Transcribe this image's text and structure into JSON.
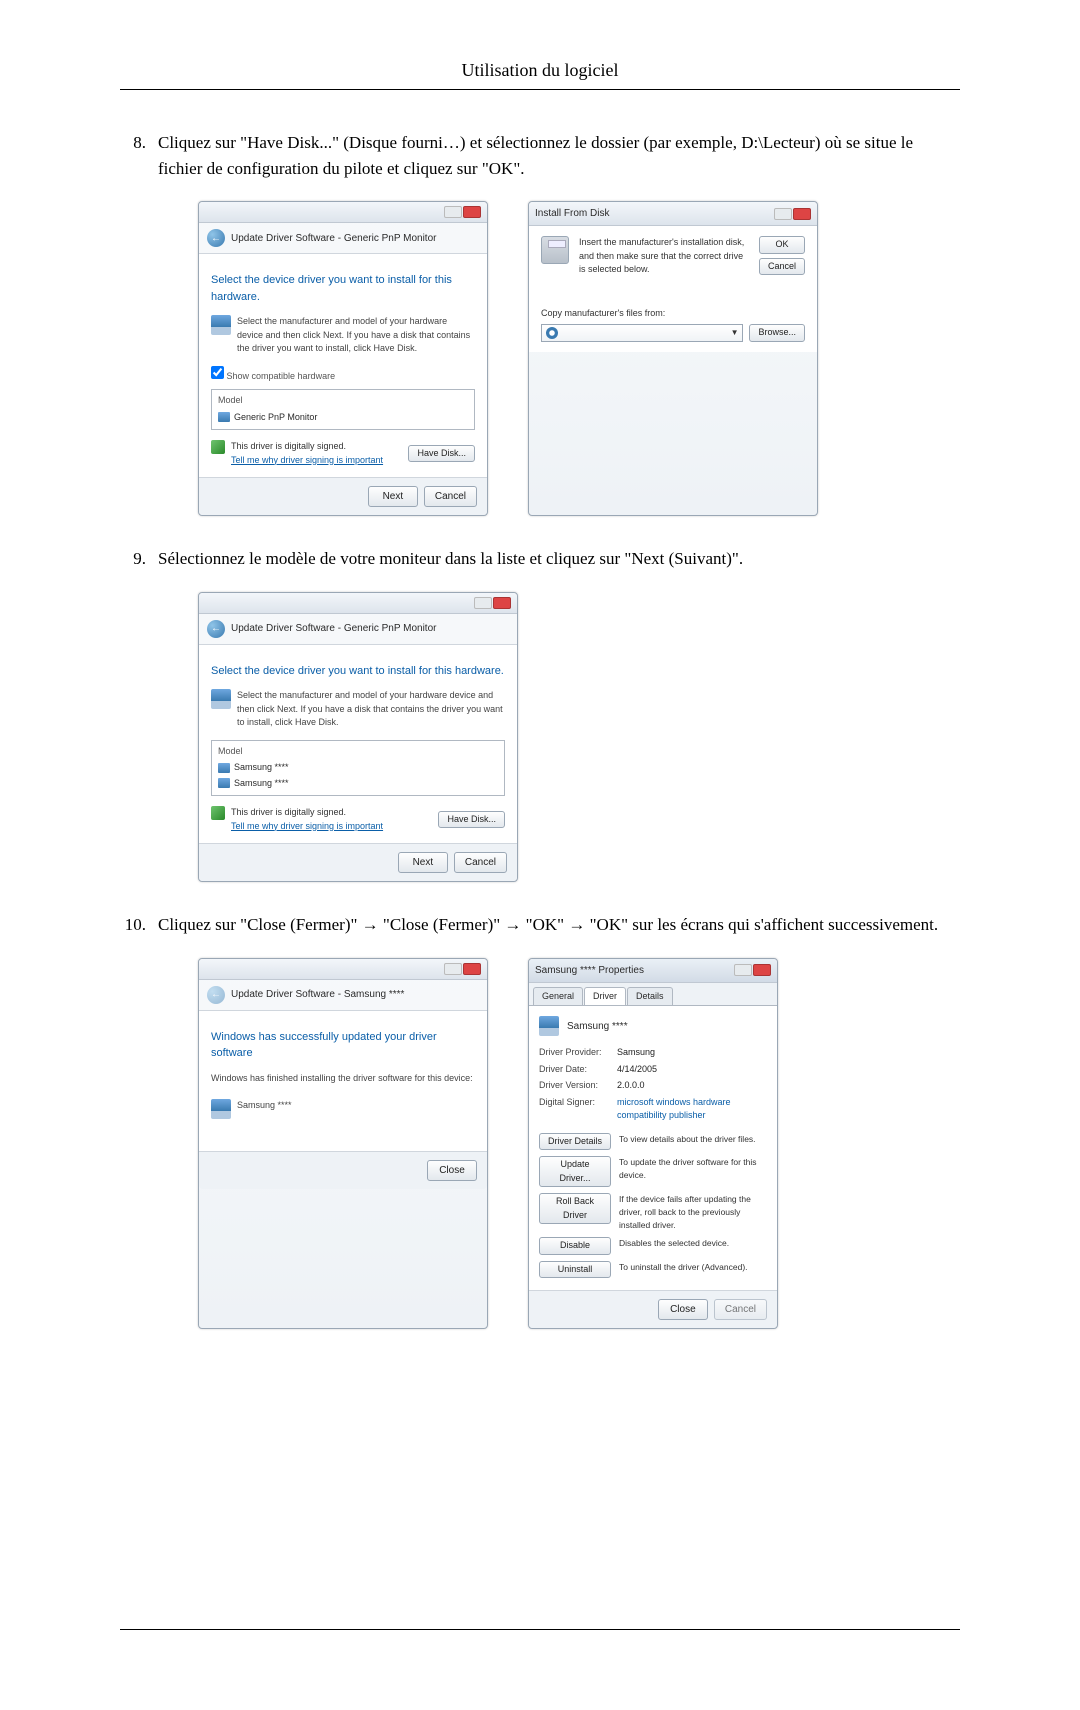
{
  "page": {
    "header": "Utilisation du logiciel"
  },
  "steps": {
    "s8": {
      "num": "8.",
      "text": "Cliquez sur \"Have Disk...\" (Disque fourni…) et sélectionnez le dossier (par exemple, D:\\Lecteur) où se situe le fichier de configuration du pilote et cliquez sur \"OK\"."
    },
    "s9": {
      "num": "9.",
      "text": "Sélectionnez le modèle de votre moniteur dans la liste et cliquez sur \"Next (Suivant)\"."
    },
    "s10": {
      "num": "10.",
      "text": "Cliquez sur \"Close (Fermer)\" → \"Close (Fermer)\" → \"OK\" → \"OK\" sur les écrans qui s'affichent successivement."
    }
  },
  "dlg1": {
    "breadcrumb": "Update Driver Software - Generic PnP Monitor",
    "heading": "Select the device driver you want to install for this hardware.",
    "sub": "Select the manufacturer and model of your hardware device and then click Next. If you have a disk that contains the driver you want to install, click Have Disk.",
    "chk": "Show compatible hardware",
    "list_label": "Model",
    "list_item": "Generic PnP Monitor",
    "sig1": "This driver is digitally signed.",
    "sig2": "Tell me why driver signing is important",
    "have_disk": "Have Disk...",
    "next": "Next",
    "cancel": "Cancel"
  },
  "dlg_ifd": {
    "title": "Install From Disk",
    "instr": "Insert the manufacturer's installation disk, and then make sure that the correct drive is selected below.",
    "ok": "OK",
    "cancel": "Cancel",
    "copy_label": "Copy manufacturer's files from:",
    "browse": "Browse..."
  },
  "dlg2": {
    "breadcrumb": "Update Driver Software - Generic PnP Monitor",
    "heading": "Select the device driver you want to install for this hardware.",
    "sub": "Select the manufacturer and model of your hardware device and then click Next. If you have a disk that contains the driver you want to install, click Have Disk.",
    "list_label": "Model",
    "list_item1": "Samsung ****",
    "list_item2": "Samsung ****",
    "sig1": "This driver is digitally signed.",
    "sig2": "Tell me why driver signing is important",
    "have_disk": "Have Disk...",
    "next": "Next",
    "cancel": "Cancel"
  },
  "dlg3": {
    "breadcrumb": "Update Driver Software - Samsung ****",
    "heading": "Windows has successfully updated your driver software",
    "sub": "Windows has finished installing the driver software for this device:",
    "device": "Samsung ****",
    "close": "Close"
  },
  "dlg_props": {
    "title": "Samsung **** Properties",
    "tabs": {
      "general": "General",
      "driver": "Driver",
      "details": "Details"
    },
    "device": "Samsung ****",
    "info": {
      "provider_k": "Driver Provider:",
      "provider_v": "Samsung",
      "date_k": "Driver Date:",
      "date_v": "4/14/2005",
      "version_k": "Driver Version:",
      "version_v": "2.0.0.0",
      "signer_k": "Digital Signer:",
      "signer_v": "microsoft windows hardware compatibility publisher"
    },
    "buttons": {
      "details": "Driver Details",
      "details_d": "To view details about the driver files.",
      "update": "Update Driver...",
      "update_d": "To update the driver software for this device.",
      "rollback": "Roll Back Driver",
      "rollback_d": "If the device fails after updating the driver, roll back to the previously installed driver.",
      "disable": "Disable",
      "disable_d": "Disables the selected device.",
      "uninstall": "Uninstall",
      "uninstall_d": "To uninstall the driver (Advanced)."
    },
    "close": "Close",
    "cancel": "Cancel"
  }
}
